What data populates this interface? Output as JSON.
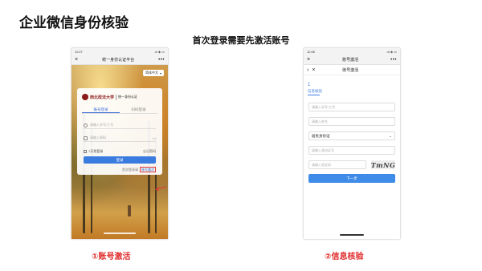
{
  "slide": {
    "title": "企业微信身份核验",
    "subtitle": "首次登录需要先激活账号"
  },
  "phone1": {
    "status_time": "11:07",
    "status_right": "•ıl ◈ ▭",
    "header_close": "×",
    "header_title": "统一身份认证平台",
    "header_more": "•••",
    "lang_label": "简体中文",
    "brand_logo_text": "西北政法大学",
    "brand_subtitle": "统一身份认证",
    "tabs": [
      {
        "label": "账号登录"
      },
      {
        "label": "扫码登录"
      }
    ],
    "username_placeholder": "请输入学号/工号",
    "password_placeholder": "请输入密码",
    "password_eye": "◡",
    "remember_label": "7天免登录",
    "forgot_label": "忘记密码",
    "login_button": "登录",
    "no_account_text": "首次登录请",
    "activate_link": "账号激活"
  },
  "phone2": {
    "status_time": "11:08",
    "status_right": "•ıl ◈ ▭",
    "header_close": "×",
    "header_title": "账号激活",
    "header_more": "•••",
    "nav_back": "‹",
    "nav_close": "×",
    "nav_title": "账号激活",
    "step_number": "1",
    "step_label": "信息核验",
    "fields": [
      {
        "placeholder": "请输入学号/工号"
      },
      {
        "placeholder": "请输入姓名"
      }
    ],
    "id_type_value": "居民身份证",
    "id_type_chevron": "⌄",
    "id_number_placeholder": "请输入身份证号",
    "captcha_placeholder": "请输入验证码",
    "captcha_text": "TmNG",
    "next_button": "下一步"
  },
  "captions": {
    "step1": "①账号激活",
    "step2": "②信息核验"
  },
  "colors": {
    "accent_blue": "#3a7be0",
    "caption_red": "#e02a2a",
    "highlight_red": "#e23b3b"
  }
}
